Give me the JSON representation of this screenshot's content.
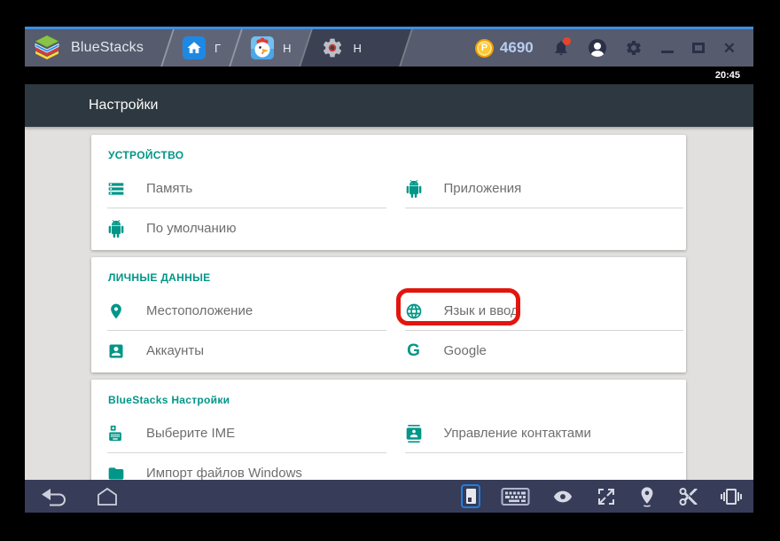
{
  "titlebar": {
    "brand": "BlueStacks",
    "tabs": [
      {
        "label": "Г",
        "icon": "home-icon",
        "active": false
      },
      {
        "label": "Н",
        "icon": "chicken-app-icon",
        "active": false
      },
      {
        "label": "Н",
        "icon": "gear-icon",
        "active": true
      }
    ],
    "coin_balance": "4690",
    "has_notification": true
  },
  "statusbar": {
    "time": "20:45"
  },
  "settings": {
    "title": "Настройки",
    "sections": [
      {
        "header": "УСТРОЙСТВО",
        "items": [
          {
            "label": "Память",
            "icon": "storage-icon"
          },
          {
            "label": "Приложения",
            "icon": "android-icon"
          },
          {
            "label": "По умолчанию",
            "icon": "android-icon"
          }
        ]
      },
      {
        "header": "ЛИЧНЫЕ ДАННЫЕ",
        "items": [
          {
            "label": "Местоположение",
            "icon": "location-pin-icon"
          },
          {
            "label": "Язык и ввод",
            "icon": "globe-icon",
            "highlighted": true
          },
          {
            "label": "Аккаунты",
            "icon": "account-box-icon"
          },
          {
            "label": "Google",
            "icon": "google-g-icon"
          }
        ]
      },
      {
        "header": "BlueStacks Настройки",
        "items": [
          {
            "label": "Выберите IME",
            "icon": "ime-keyboard-icon"
          },
          {
            "label": "Управление контактами",
            "icon": "contacts-icon"
          },
          {
            "label": "Импорт файлов Windows",
            "icon": "folder-icon"
          }
        ]
      }
    ]
  },
  "navbar": {
    "left_icons": [
      "back-icon",
      "home-icon"
    ],
    "right_icons": [
      "dock-toggle-icon",
      "keyboard-icon",
      "eye-icon",
      "fullscreen-icon",
      "location-icon",
      "scissors-icon",
      "shake-icon"
    ]
  },
  "icon_glyphs": {
    "coin_letter": "P",
    "google_g": "G",
    "close": "✕"
  },
  "colors": {
    "accent_teal": "#009688",
    "highlight_red": "#e2160e",
    "titlebar": "#565b6d",
    "navbar": "#373c58",
    "coin_gold": "#fdc835",
    "tab_blue": "#1e88e5"
  }
}
